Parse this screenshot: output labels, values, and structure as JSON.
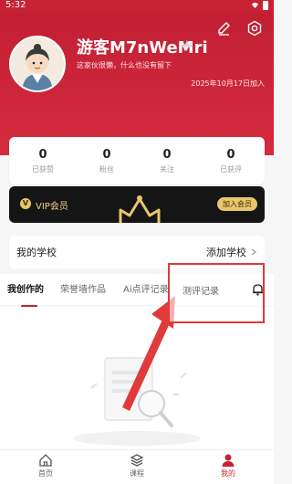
{
  "status_bar": {
    "time": "5:32"
  },
  "profile": {
    "username": "游客M7nWeMri",
    "bio": "这家伙很懒，什么也没有留下",
    "join_date": "2025年10月17日加入"
  },
  "stats": [
    {
      "value": "0",
      "label": "已获赞"
    },
    {
      "value": "0",
      "label": "粉丝"
    },
    {
      "value": "0",
      "label": "关注"
    },
    {
      "value": "0",
      "label": "已获评"
    }
  ],
  "vip": {
    "label": "VIP会员",
    "badge": "V",
    "join": "加入会员"
  },
  "school": {
    "label": "我的学校",
    "action": "添加学校"
  },
  "tabs": [
    {
      "label": "我创作的"
    },
    {
      "label": "荣誉墙作品"
    },
    {
      "label": "Ai点评记录"
    }
  ],
  "highlight": {
    "label": "测评记录"
  },
  "bottom_nav": [
    {
      "label": "首页"
    },
    {
      "label": "课程"
    },
    {
      "label": "我的"
    }
  ],
  "colors": {
    "brand": "#c62234",
    "vip_gold": "#e9c66d",
    "annotation": "#e03a3a"
  }
}
